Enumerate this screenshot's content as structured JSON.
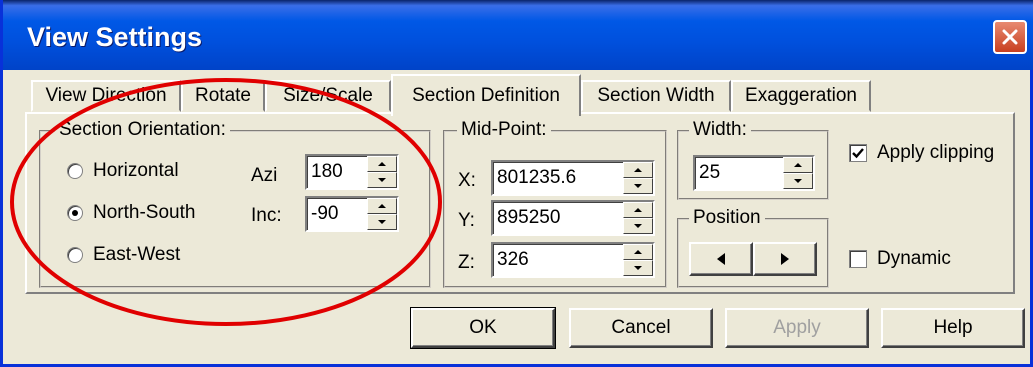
{
  "window": {
    "title": "View Settings"
  },
  "tabs": [
    "View Direction",
    "Rotate",
    "Size/Scale",
    "Section Definition",
    "Section Width",
    "Exaggeration"
  ],
  "active_tab": "Section Definition",
  "section_orientation": {
    "legend": "Section Orientation:",
    "options": [
      "Horizontal",
      "North-South",
      "East-West"
    ],
    "selected": "North-South",
    "azi_label": "Azi",
    "azi_value": "180",
    "inc_label": "Inc:",
    "inc_value": "-90"
  },
  "mid_point": {
    "legend": "Mid-Point:",
    "x_label": "X:",
    "x_value": "801235.6",
    "y_label": "Y:",
    "y_value": "895250",
    "z_label": "Z:",
    "z_value": "326"
  },
  "width": {
    "legend": "Width:",
    "value": "25"
  },
  "position": {
    "legend": "Position"
  },
  "apply_clipping": {
    "label": "Apply clipping",
    "checked": true
  },
  "dynamic": {
    "label": "Dynamic",
    "checked": false
  },
  "buttons": {
    "ok": "OK",
    "cancel": "Cancel",
    "apply": "Apply",
    "help": "Help"
  },
  "colors": {
    "titlebar": "#0054e3",
    "face": "#ece9d8",
    "annotation": "#e00000"
  }
}
